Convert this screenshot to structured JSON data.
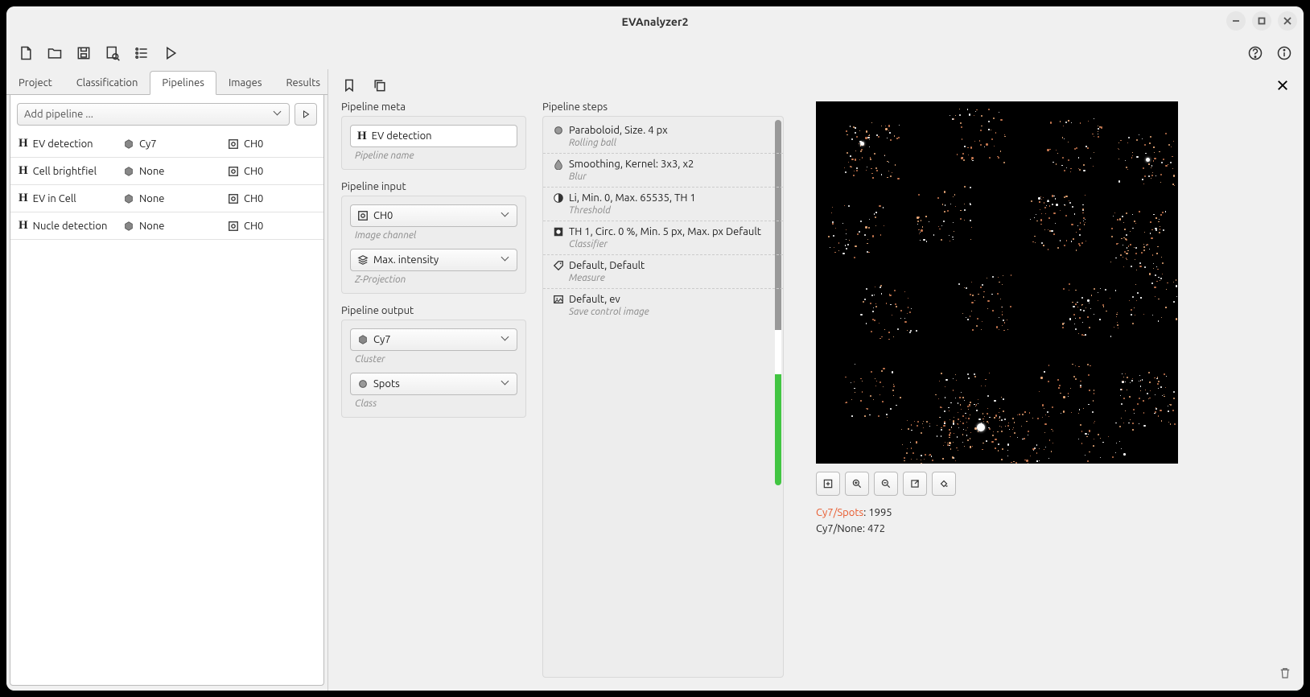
{
  "window": {
    "title": "EVAnalyzer2"
  },
  "tabs": [
    "Project",
    "Classification",
    "Pipelines",
    "Images",
    "Results"
  ],
  "active_tab": "Pipelines",
  "add_pipeline_placeholder": "Add pipeline ...",
  "pipelines": [
    {
      "name": "EV detection",
      "cluster": "Cy7",
      "channel": "CH0"
    },
    {
      "name": "Cell brightfiel",
      "cluster": "None",
      "channel": "CH0"
    },
    {
      "name": "EV in Cell",
      "cluster": "None",
      "channel": "CH0"
    },
    {
      "name": "Nucle detection",
      "cluster": "None",
      "channel": "CH0"
    }
  ],
  "meta": {
    "section_label": "Pipeline meta",
    "name_value": "EV detection",
    "name_caption": "Pipeline name"
  },
  "input": {
    "section_label": "Pipeline input",
    "channel_value": "CH0",
    "channel_caption": "Image channel",
    "zproj_value": "Max. intensity",
    "zproj_caption": "Z-Projection"
  },
  "output": {
    "section_label": "Pipeline output",
    "cluster_value": "Cy7",
    "cluster_caption": "Cluster",
    "class_value": "Spots",
    "class_caption": "Class"
  },
  "steps_label": "Pipeline steps",
  "steps": [
    {
      "title": "Paraboloid, Size. 4 px",
      "caption": "Rolling ball",
      "icon": "circle"
    },
    {
      "title": "Smoothing, Kernel: 3x3, x2",
      "caption": "Blur",
      "icon": "drop"
    },
    {
      "title": "Li, Min. 0, Max. 65535, TH 1",
      "caption": "Threshold",
      "icon": "contrast"
    },
    {
      "title": "TH 1, Circ. 0 %, Min. 5 px, Max. px Default",
      "caption": "Classifier",
      "icon": "target"
    },
    {
      "title": "Default, Default",
      "caption": "Measure",
      "icon": "tag"
    },
    {
      "title": "Default, ev",
      "caption": "Save control image",
      "icon": "image"
    }
  ],
  "preview": {
    "stats": [
      {
        "key": "Cy7/Spots",
        "value": "1995",
        "highlight": true
      },
      {
        "key": "Cy7/None",
        "value": "472",
        "highlight": false
      }
    ]
  }
}
